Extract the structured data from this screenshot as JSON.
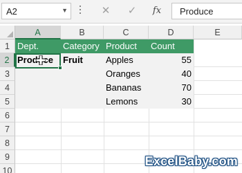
{
  "formula_bar": {
    "name_box": "A2",
    "cancel_symbol": "✕",
    "enter_symbol": "✓",
    "fx_label": "fx",
    "content": "Produce"
  },
  "columns": [
    "A",
    "B",
    "C",
    "D",
    "E"
  ],
  "rows": [
    "1",
    "2",
    "3",
    "4",
    "5",
    "6",
    "7",
    "8",
    "9",
    "10"
  ],
  "selected_cell": "A2",
  "cells": {
    "a1": "Dept.",
    "b1": "Category",
    "c1": "Product",
    "d1": "Count",
    "a2": "Produce",
    "b2": "Fruit",
    "c2": "Apples",
    "d2": "55",
    "c3": "Oranges",
    "d3": "40",
    "c4": "Bananas",
    "d4": "70",
    "c5": "Lemons",
    "d5": "30"
  },
  "colors": {
    "header_fill": "#3f9a66",
    "selection": "#217346",
    "band_fill": "#f2f2f2"
  },
  "watermark": "ExcelBaby.com"
}
